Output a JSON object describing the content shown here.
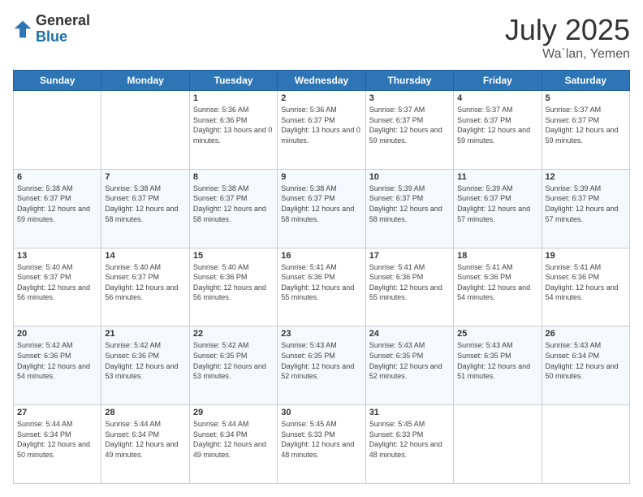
{
  "header": {
    "logo_general": "General",
    "logo_blue": "Blue",
    "month_title": "July 2025",
    "location": "Wa`lan, Yemen"
  },
  "days_of_week": [
    "Sunday",
    "Monday",
    "Tuesday",
    "Wednesday",
    "Thursday",
    "Friday",
    "Saturday"
  ],
  "weeks": [
    [
      {
        "day": "",
        "sunrise": "",
        "sunset": "",
        "daylight": ""
      },
      {
        "day": "",
        "sunrise": "",
        "sunset": "",
        "daylight": ""
      },
      {
        "day": "1",
        "sunrise": "Sunrise: 5:36 AM",
        "sunset": "Sunset: 6:36 PM",
        "daylight": "Daylight: 13 hours and 0 minutes."
      },
      {
        "day": "2",
        "sunrise": "Sunrise: 5:36 AM",
        "sunset": "Sunset: 6:37 PM",
        "daylight": "Daylight: 13 hours and 0 minutes."
      },
      {
        "day": "3",
        "sunrise": "Sunrise: 5:37 AM",
        "sunset": "Sunset: 6:37 PM",
        "daylight": "Daylight: 12 hours and 59 minutes."
      },
      {
        "day": "4",
        "sunrise": "Sunrise: 5:37 AM",
        "sunset": "Sunset: 6:37 PM",
        "daylight": "Daylight: 12 hours and 59 minutes."
      },
      {
        "day": "5",
        "sunrise": "Sunrise: 5:37 AM",
        "sunset": "Sunset: 6:37 PM",
        "daylight": "Daylight: 12 hours and 59 minutes."
      }
    ],
    [
      {
        "day": "6",
        "sunrise": "Sunrise: 5:38 AM",
        "sunset": "Sunset: 6:37 PM",
        "daylight": "Daylight: 12 hours and 59 minutes."
      },
      {
        "day": "7",
        "sunrise": "Sunrise: 5:38 AM",
        "sunset": "Sunset: 6:37 PM",
        "daylight": "Daylight: 12 hours and 58 minutes."
      },
      {
        "day": "8",
        "sunrise": "Sunrise: 5:38 AM",
        "sunset": "Sunset: 6:37 PM",
        "daylight": "Daylight: 12 hours and 58 minutes."
      },
      {
        "day": "9",
        "sunrise": "Sunrise: 5:38 AM",
        "sunset": "Sunset: 6:37 PM",
        "daylight": "Daylight: 12 hours and 58 minutes."
      },
      {
        "day": "10",
        "sunrise": "Sunrise: 5:39 AM",
        "sunset": "Sunset: 6:37 PM",
        "daylight": "Daylight: 12 hours and 58 minutes."
      },
      {
        "day": "11",
        "sunrise": "Sunrise: 5:39 AM",
        "sunset": "Sunset: 6:37 PM",
        "daylight": "Daylight: 12 hours and 57 minutes."
      },
      {
        "day": "12",
        "sunrise": "Sunrise: 5:39 AM",
        "sunset": "Sunset: 6:37 PM",
        "daylight": "Daylight: 12 hours and 57 minutes."
      }
    ],
    [
      {
        "day": "13",
        "sunrise": "Sunrise: 5:40 AM",
        "sunset": "Sunset: 6:37 PM",
        "daylight": "Daylight: 12 hours and 56 minutes."
      },
      {
        "day": "14",
        "sunrise": "Sunrise: 5:40 AM",
        "sunset": "Sunset: 6:37 PM",
        "daylight": "Daylight: 12 hours and 56 minutes."
      },
      {
        "day": "15",
        "sunrise": "Sunrise: 5:40 AM",
        "sunset": "Sunset: 6:36 PM",
        "daylight": "Daylight: 12 hours and 56 minutes."
      },
      {
        "day": "16",
        "sunrise": "Sunrise: 5:41 AM",
        "sunset": "Sunset: 6:36 PM",
        "daylight": "Daylight: 12 hours and 55 minutes."
      },
      {
        "day": "17",
        "sunrise": "Sunrise: 5:41 AM",
        "sunset": "Sunset: 6:36 PM",
        "daylight": "Daylight: 12 hours and 55 minutes."
      },
      {
        "day": "18",
        "sunrise": "Sunrise: 5:41 AM",
        "sunset": "Sunset: 6:36 PM",
        "daylight": "Daylight: 12 hours and 54 minutes."
      },
      {
        "day": "19",
        "sunrise": "Sunrise: 5:41 AM",
        "sunset": "Sunset: 6:36 PM",
        "daylight": "Daylight: 12 hours and 54 minutes."
      }
    ],
    [
      {
        "day": "20",
        "sunrise": "Sunrise: 5:42 AM",
        "sunset": "Sunset: 6:36 PM",
        "daylight": "Daylight: 12 hours and 54 minutes."
      },
      {
        "day": "21",
        "sunrise": "Sunrise: 5:42 AM",
        "sunset": "Sunset: 6:36 PM",
        "daylight": "Daylight: 12 hours and 53 minutes."
      },
      {
        "day": "22",
        "sunrise": "Sunrise: 5:42 AM",
        "sunset": "Sunset: 6:35 PM",
        "daylight": "Daylight: 12 hours and 53 minutes."
      },
      {
        "day": "23",
        "sunrise": "Sunrise: 5:43 AM",
        "sunset": "Sunset: 6:35 PM",
        "daylight": "Daylight: 12 hours and 52 minutes."
      },
      {
        "day": "24",
        "sunrise": "Sunrise: 5:43 AM",
        "sunset": "Sunset: 6:35 PM",
        "daylight": "Daylight: 12 hours and 52 minutes."
      },
      {
        "day": "25",
        "sunrise": "Sunrise: 5:43 AM",
        "sunset": "Sunset: 6:35 PM",
        "daylight": "Daylight: 12 hours and 51 minutes."
      },
      {
        "day": "26",
        "sunrise": "Sunrise: 5:43 AM",
        "sunset": "Sunset: 6:34 PM",
        "daylight": "Daylight: 12 hours and 50 minutes."
      }
    ],
    [
      {
        "day": "27",
        "sunrise": "Sunrise: 5:44 AM",
        "sunset": "Sunset: 6:34 PM",
        "daylight": "Daylight: 12 hours and 50 minutes."
      },
      {
        "day": "28",
        "sunrise": "Sunrise: 5:44 AM",
        "sunset": "Sunset: 6:34 PM",
        "daylight": "Daylight: 12 hours and 49 minutes."
      },
      {
        "day": "29",
        "sunrise": "Sunrise: 5:44 AM",
        "sunset": "Sunset: 6:34 PM",
        "daylight": "Daylight: 12 hours and 49 minutes."
      },
      {
        "day": "30",
        "sunrise": "Sunrise: 5:45 AM",
        "sunset": "Sunset: 6:33 PM",
        "daylight": "Daylight: 12 hours and 48 minutes."
      },
      {
        "day": "31",
        "sunrise": "Sunrise: 5:45 AM",
        "sunset": "Sunset: 6:33 PM",
        "daylight": "Daylight: 12 hours and 48 minutes."
      },
      {
        "day": "",
        "sunrise": "",
        "sunset": "",
        "daylight": ""
      },
      {
        "day": "",
        "sunrise": "",
        "sunset": "",
        "daylight": ""
      }
    ]
  ]
}
